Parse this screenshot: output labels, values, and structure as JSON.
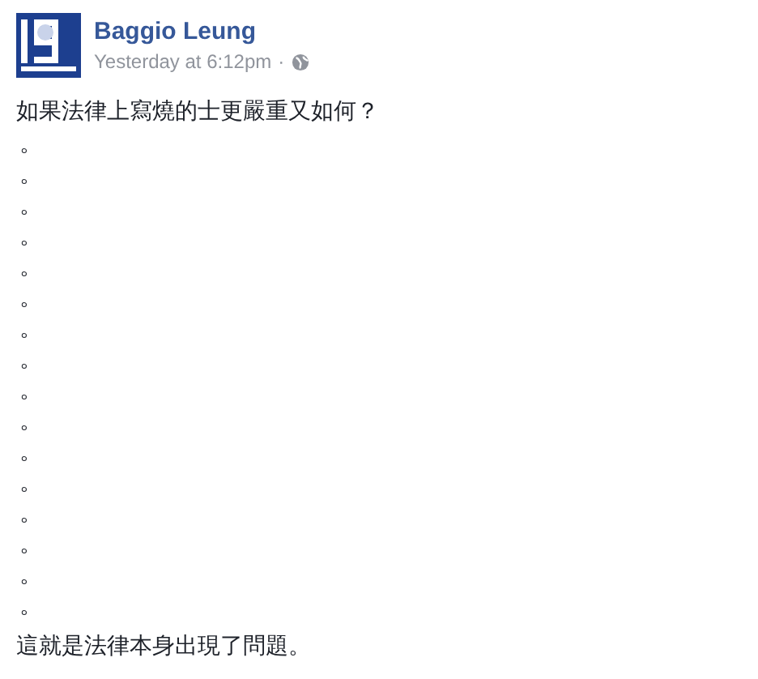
{
  "post": {
    "author": "Baggio Leung",
    "time": "Yesterday at 6:12pm",
    "separator": "·"
  },
  "lines": [
    "如果法律上寫燒的士更嚴重又如何？",
    "。",
    "。",
    "。",
    "。",
    "。",
    "。",
    "。",
    "。",
    "。",
    "。",
    "。",
    "。",
    "。",
    "。",
    "。",
    "。",
    "這就是法律本身出現了問題。"
  ]
}
